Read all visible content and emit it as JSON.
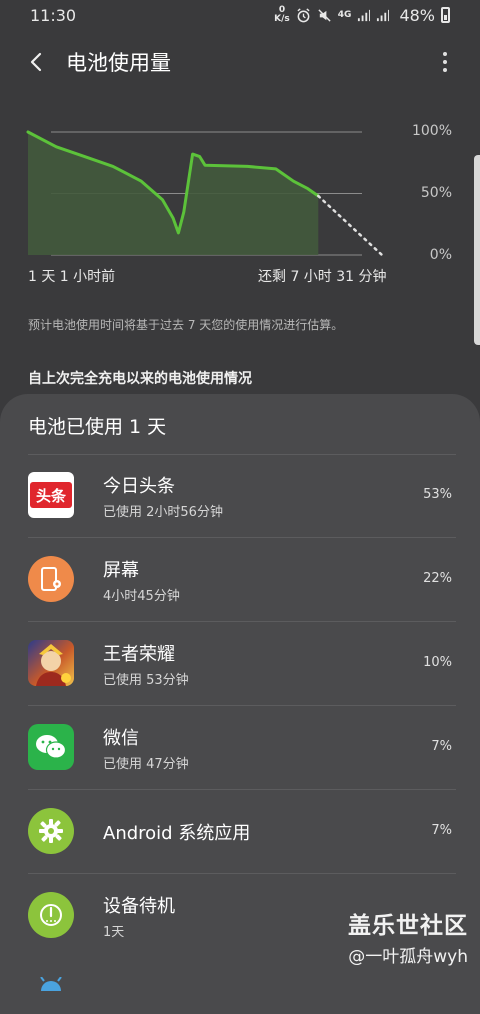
{
  "status_bar": {
    "time": "11:30",
    "net_speed_value": "0",
    "net_speed_unit": "K/s",
    "network": "4G",
    "battery_percent": "48%"
  },
  "app_bar": {
    "title": "电池使用量"
  },
  "chart_data": {
    "type": "line",
    "y_ticks": [
      "100%",
      "50%",
      "0%"
    ],
    "ylim": [
      0,
      100
    ],
    "x_start_label": "1 天 1 小时前",
    "x_end_label": "还剩 7 小时 31 分钟",
    "grid": true,
    "series": [
      {
        "values": [
          {
            "x": 0.0,
            "y": 100
          },
          {
            "x": 0.08,
            "y": 88
          },
          {
            "x": 0.16,
            "y": 80
          },
          {
            "x": 0.24,
            "y": 72
          },
          {
            "x": 0.32,
            "y": 60
          },
          {
            "x": 0.38,
            "y": 45
          },
          {
            "x": 0.41,
            "y": 30
          },
          {
            "x": 0.425,
            "y": 18
          },
          {
            "x": 0.44,
            "y": 35
          },
          {
            "x": 0.465,
            "y": 82
          },
          {
            "x": 0.485,
            "y": 80
          },
          {
            "x": 0.5,
            "y": 73
          },
          {
            "x": 0.62,
            "y": 72
          },
          {
            "x": 0.7,
            "y": 70
          },
          {
            "x": 0.75,
            "y": 60
          },
          {
            "x": 0.79,
            "y": 54
          },
          {
            "x": 0.82,
            "y": 48
          }
        ]
      },
      {
        "style": "dotted",
        "values": [
          {
            "x": 0.82,
            "y": 48
          },
          {
            "x": 1.0,
            "y": 0
          }
        ]
      }
    ],
    "colors": {
      "line": "#5cc23a",
      "fill": "#425a3c",
      "projection": "#e0e0e0",
      "grid": "#8c8c8c"
    }
  },
  "estimate_note": "预计电池使用时间将基于过去 7 天您的使用情况进行估算。",
  "section_title": "自上次完全充电以来的电池使用情况",
  "sheet": {
    "title": "电池已使用 1 天",
    "apps": [
      {
        "name": "今日头条",
        "usage": "已使用 2小时56分钟",
        "percent": "53%",
        "icon": "toutiao-icon",
        "icon_text": "头条"
      },
      {
        "name": "屏幕",
        "usage": "4小时45分钟",
        "percent": "22%",
        "icon": "screen-icon"
      },
      {
        "name": "王者荣耀",
        "usage": "已使用 53分钟",
        "percent": "10%",
        "icon": "game-icon"
      },
      {
        "name": "微信",
        "usage": "已使用 47分钟",
        "percent": "7%",
        "icon": "wechat-icon"
      },
      {
        "name": "Android 系统应用",
        "usage": "",
        "percent": "7%",
        "icon": "gear-icon"
      },
      {
        "name": "设备待机",
        "usage": "1天",
        "percent": "",
        "icon": "power-icon"
      }
    ]
  },
  "watermark": {
    "title": "盖乐世社区",
    "sub": "@一叶孤舟wyh"
  }
}
